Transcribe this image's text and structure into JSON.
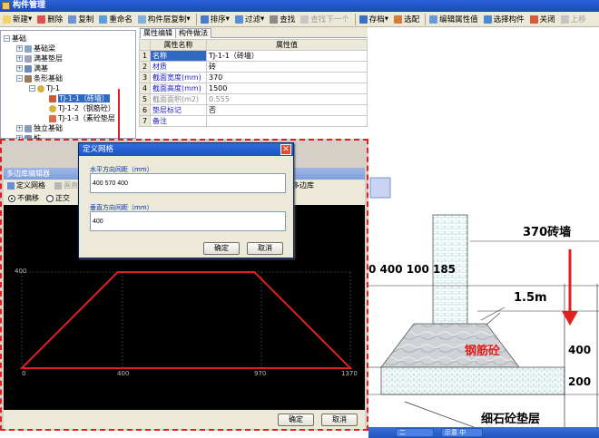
{
  "window": {
    "title": "构件管理"
  },
  "toolbar": {
    "new": "新建",
    "delete": "删除",
    "copy": "复制",
    "rename": "重命名",
    "layer_copy": "构件层复制",
    "sort": "排序",
    "filter": "过滤",
    "find": "查找",
    "find_next": "查找下一个",
    "save": "存档",
    "match": "选配",
    "edit_attr": "编辑属性值",
    "select": "选择构件",
    "close": "关闭",
    "up": "上移"
  },
  "tree": {
    "root": "基础",
    "items": [
      {
        "label": "基础梁"
      },
      {
        "label": "满基垫层"
      },
      {
        "label": "满基"
      },
      {
        "label": "条形基础"
      },
      {
        "label": "TJ-1"
      },
      {
        "label": "TJ-1-1（砖墙）"
      },
      {
        "label": "TJ-1-2（钢筋砼）"
      },
      {
        "label": "TJ-1-3（素砼垫层"
      },
      {
        "label": "独立基础"
      },
      {
        "label": "桩"
      }
    ]
  },
  "props": {
    "tabs": [
      "属性编辑",
      "构件做法"
    ],
    "header_name": "属性名称",
    "header_value": "属性值",
    "rows": [
      {
        "no": "1",
        "name": "名称",
        "value": "TJ-1-1（砖墙）"
      },
      {
        "no": "2",
        "name": "材质",
        "value": "砖"
      },
      {
        "no": "3",
        "name": "截面宽度(mm)",
        "value": "370"
      },
      {
        "no": "4",
        "name": "截面高度(mm)",
        "value": "1500"
      },
      {
        "no": "5",
        "name": "截面面积(m2)",
        "value": "0.555"
      },
      {
        "no": "6",
        "name": "垫层标记",
        "value": "否"
      },
      {
        "no": "7",
        "name": "备注",
        "value": ""
      }
    ]
  },
  "polyeditor": {
    "title": "多边库编辑器",
    "toolbar_define_grid": "定义网格",
    "toolbar_draw": "画直线",
    "toolbar_library": "多边库",
    "radio_no_offset": "不偏移",
    "radio_ortho": "正交",
    "y_tick": "400",
    "x_ticks": [
      "0",
      "400",
      "970",
      "1370"
    ],
    "ok": "确定",
    "cancel": "取消",
    "shape_points": [
      [
        0,
        0
      ],
      [
        400,
        400
      ],
      [
        970,
        400
      ],
      [
        1370,
        0
      ]
    ]
  },
  "griddlg": {
    "title": "定义网格",
    "h_label": "水平方向间距（mm）",
    "h_value": "400 570 400",
    "v_label": "垂直方向间距（mm）",
    "v_value": "400",
    "ok": "确定",
    "cancel": "取消"
  },
  "cad": {
    "wall_label": "370砖墙",
    "dims_left": "0 400 100 185",
    "height_label": "1.5m",
    "rc_label": "钢筋砼",
    "dim_400": "400",
    "dim_200": "200",
    "cushion_label": "细石砼垫层"
  },
  "taskbar": {
    "task1": "二",
    "task2": "示意 中"
  },
  "colors": {
    "accent_red": "#e02020",
    "title_blue": "#1b52c3",
    "select_blue": "#316ac5"
  }
}
